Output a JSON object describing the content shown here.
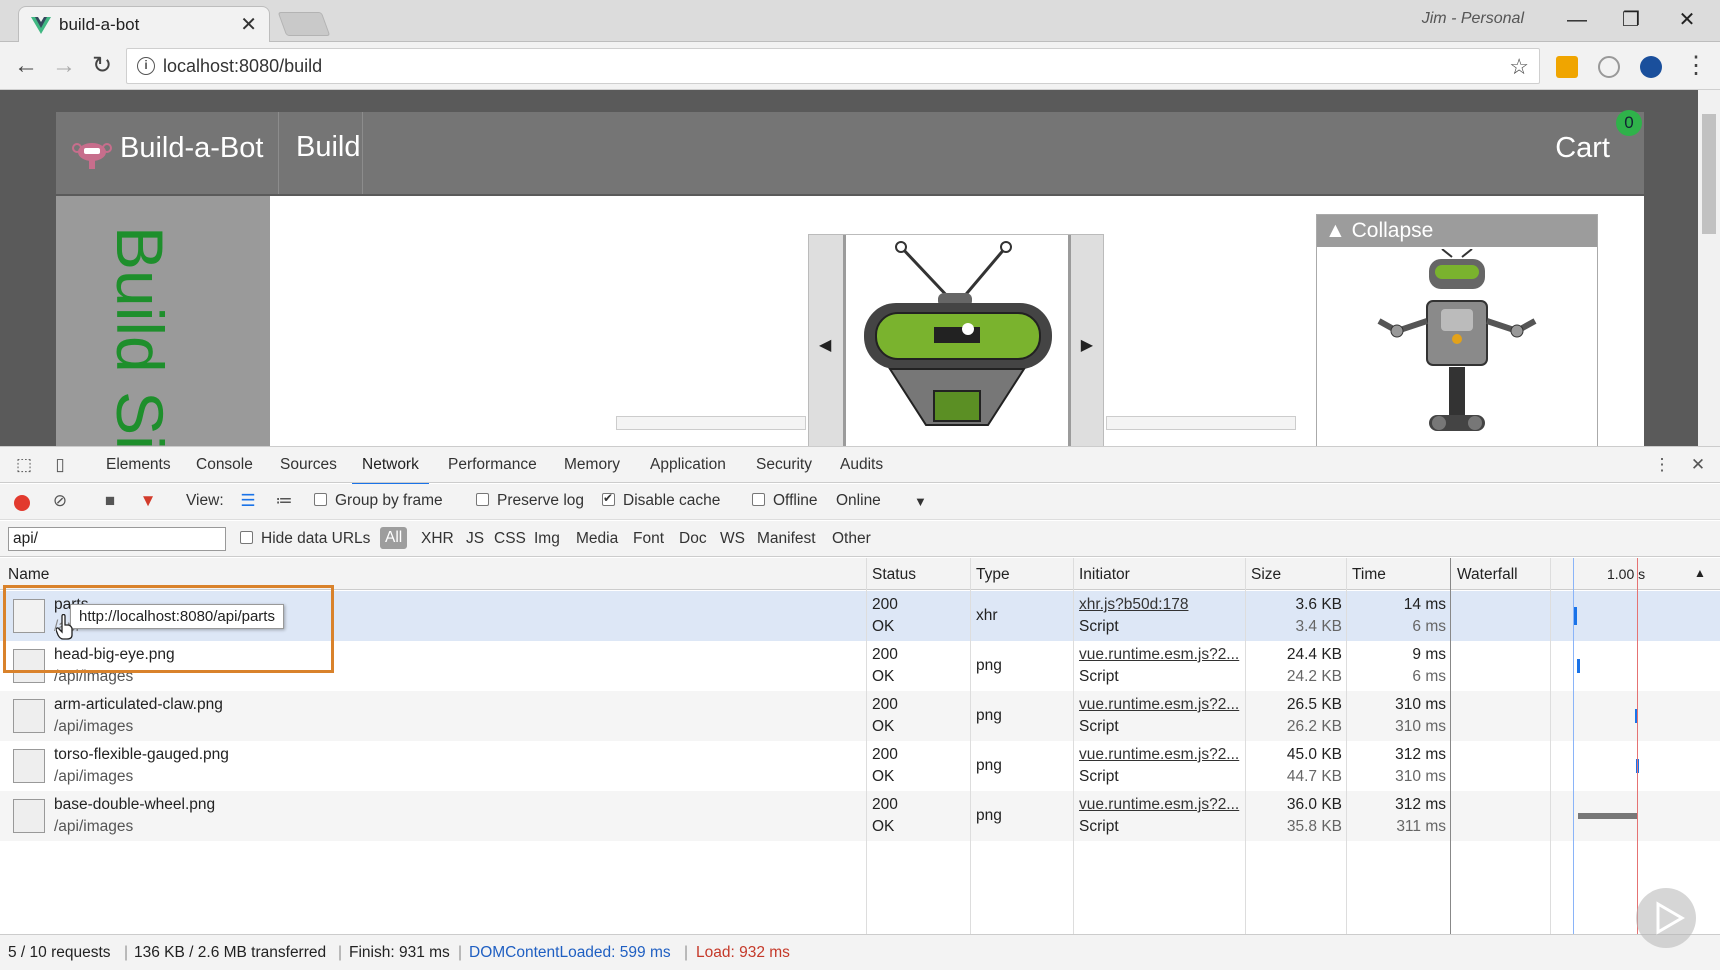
{
  "browser": {
    "tab_title": "build-a-bot",
    "tab_close": "✕",
    "profile": "Jim - Personal",
    "window_min": "—",
    "window_restore": "❐",
    "window_close": "✕",
    "url": "localhost:8080/build",
    "back": "←",
    "forward": "→",
    "reload": "↻",
    "info": "i",
    "star": "☆",
    "menu": "⋮",
    "accent": "#41b883"
  },
  "app": {
    "brand": "Build-a-Bot",
    "nav_build": "Build",
    "cart_label": "Cart",
    "cart_count": "0",
    "sidebar_text": "Build Sidebar",
    "prev_arrow": "◀",
    "next_arrow": "▶",
    "collapse_label": "▲ Collapse"
  },
  "devtools": {
    "tabs": [
      "Elements",
      "Console",
      "Sources",
      "Network",
      "Performance",
      "Memory",
      "Application",
      "Security",
      "Audits"
    ],
    "active_tab": "Network",
    "more": "⋮",
    "close": "✕",
    "controls": {
      "view_label": "View:",
      "group_by_frame": "Group by frame",
      "preserve_log": "Preserve log",
      "disable_cache": "Disable cache",
      "offline": "Offline",
      "throttle": "Online",
      "throttle_arrow": "▼"
    },
    "filter": {
      "value": "api/",
      "hide_data_urls": "Hide data URLs",
      "types": [
        "All",
        "XHR",
        "JS",
        "CSS",
        "Img",
        "Media",
        "Font",
        "Doc",
        "WS",
        "Manifest",
        "Other"
      ]
    },
    "columns": {
      "name": "Name",
      "status": "Status",
      "type": "Type",
      "initiator": "Initiator",
      "size": "Size",
      "time": "Time",
      "waterfall": "Waterfall",
      "waterfall_scale": "1.00 s",
      "sort_arrow": "▲"
    },
    "rows": [
      {
        "name": "parts",
        "path": "/api",
        "status": "200",
        "status_text": "OK",
        "type": "xhr",
        "initiator": "xhr.js?b50d:178",
        "initiator_type": "Script",
        "size": "3.6 KB",
        "content": "3.4 KB",
        "time": "14 ms",
        "latency": "6 ms"
      },
      {
        "name": "head-big-eye.png",
        "path": "/api/images",
        "status": "200",
        "status_text": "OK",
        "type": "png",
        "initiator": "vue.runtime.esm.js?2...",
        "initiator_type": "Script",
        "size": "24.4 KB",
        "content": "24.2 KB",
        "time": "9 ms",
        "latency": "6 ms"
      },
      {
        "name": "arm-articulated-claw.png",
        "path": "/api/images",
        "status": "200",
        "status_text": "OK",
        "type": "png",
        "initiator": "vue.runtime.esm.js?2...",
        "initiator_type": "Script",
        "size": "26.5 KB",
        "content": "26.2 KB",
        "time": "310 ms",
        "latency": "310 ms"
      },
      {
        "name": "torso-flexible-gauged.png",
        "path": "/api/images",
        "status": "200",
        "status_text": "OK",
        "type": "png",
        "initiator": "vue.runtime.esm.js?2...",
        "initiator_type": "Script",
        "size": "45.0 KB",
        "content": "44.7 KB",
        "time": "312 ms",
        "latency": "310 ms"
      },
      {
        "name": "base-double-wheel.png",
        "path": "/api/images",
        "status": "200",
        "status_text": "OK",
        "type": "png",
        "initiator": "vue.runtime.esm.js?2...",
        "initiator_type": "Script",
        "size": "36.0 KB",
        "content": "35.8 KB",
        "time": "312 ms",
        "latency": "311 ms"
      }
    ],
    "tooltip": "http://localhost:8080/api/parts",
    "status": {
      "requests": "5 / 10 requests",
      "transferred": "136 KB / 2.6 MB transferred",
      "finish": "Finish: 931 ms",
      "dcl": "DOMContentLoaded: 599 ms",
      "load": "Load: 932 ms",
      "sep": "|"
    }
  }
}
